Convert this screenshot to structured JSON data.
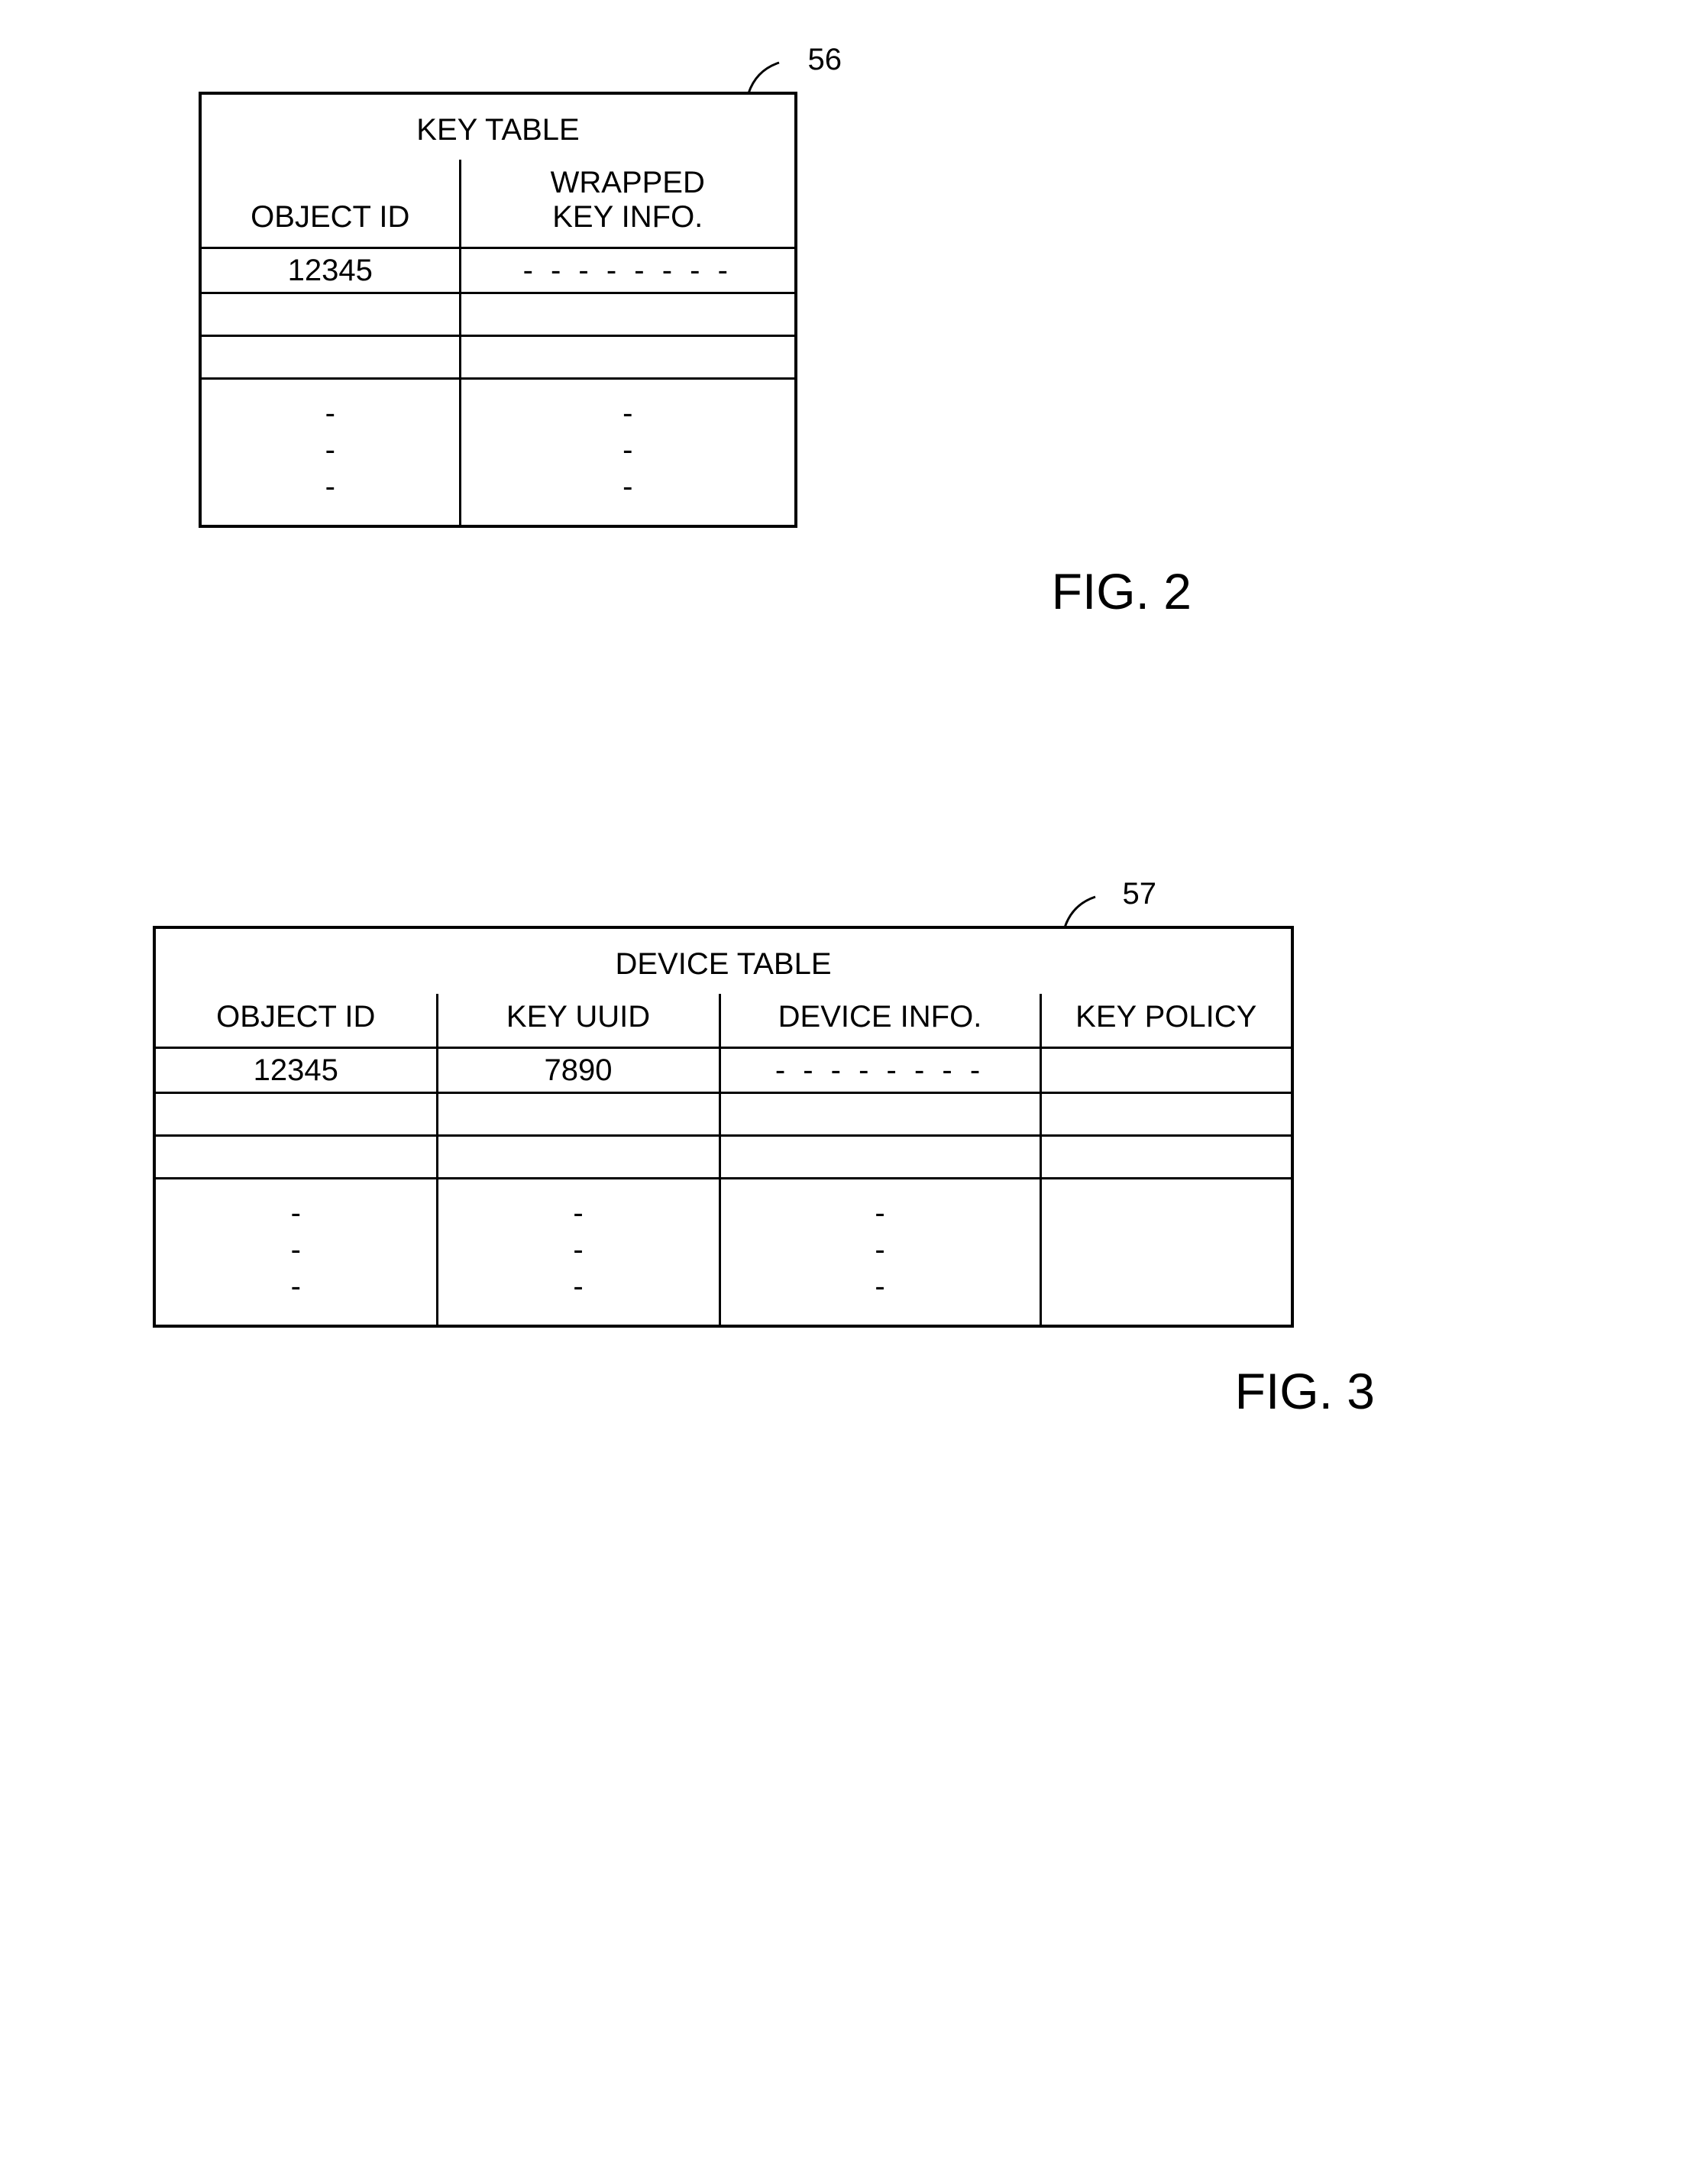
{
  "figure1": {
    "ref_number": "56",
    "title": "KEY TABLE",
    "columns": [
      "OBJECT ID",
      "WRAPPED\nKEY INFO."
    ],
    "rows": [
      {
        "object_id": "12345",
        "wrapped_key": "- - - - - - - -"
      },
      {
        "object_id": "",
        "wrapped_key": ""
      },
      {
        "object_id": "",
        "wrapped_key": ""
      }
    ],
    "vdots": [
      "-\n-\n-",
      "-\n-\n-"
    ],
    "caption": "FIG. 2"
  },
  "figure2": {
    "ref_number": "57",
    "title": "DEVICE TABLE",
    "columns": [
      "OBJECT ID",
      "KEY UUID",
      "DEVICE INFO.",
      "KEY POLICY"
    ],
    "rows": [
      {
        "object_id": "12345",
        "key_uuid": "7890",
        "device_info": "- - - - - - - -",
        "key_policy": ""
      },
      {
        "object_id": "",
        "key_uuid": "",
        "device_info": "",
        "key_policy": ""
      },
      {
        "object_id": "",
        "key_uuid": "",
        "device_info": "",
        "key_policy": ""
      }
    ],
    "vdots": [
      "-\n-\n-",
      "-\n-\n-",
      "-\n-\n-",
      ""
    ],
    "caption": "FIG. 3"
  }
}
